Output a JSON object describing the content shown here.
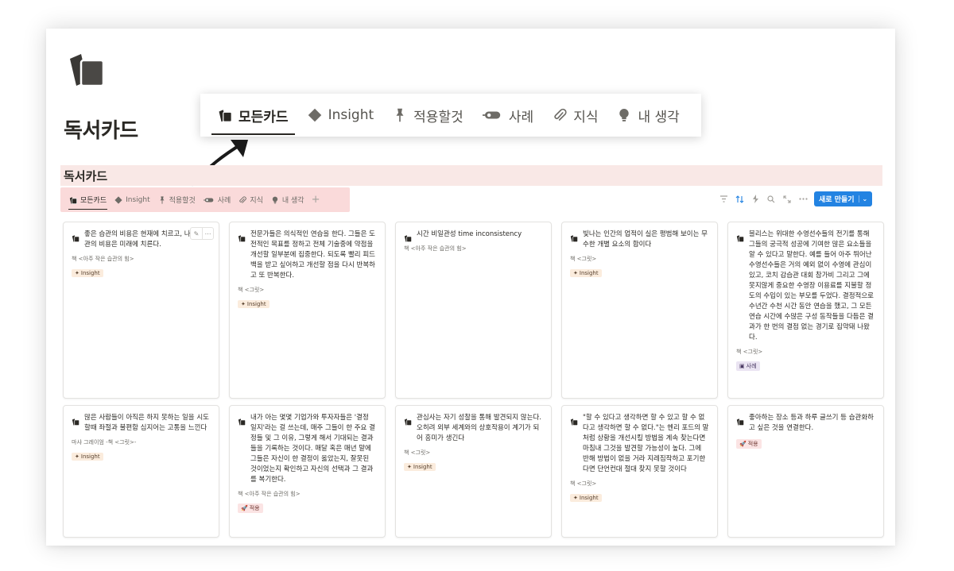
{
  "page": {
    "title": "독서카드",
    "database_title": "독서카드"
  },
  "zoom_tabs": [
    {
      "label": "모든카드",
      "icon": "cards-icon",
      "active": true
    },
    {
      "label": "Insight",
      "icon": "diamond-icon"
    },
    {
      "label": "적용할것",
      "icon": "pin-icon"
    },
    {
      "label": "사례",
      "icon": "tape-icon"
    },
    {
      "label": "지식",
      "icon": "paperclip-icon"
    },
    {
      "label": "내 생각",
      "icon": "lightbulb-icon"
    }
  ],
  "view_tabs": [
    {
      "label": "모든카드",
      "icon": "cards-icon",
      "active": true
    },
    {
      "label": "Insight",
      "icon": "diamond-icon"
    },
    {
      "label": "적용할것",
      "icon": "pin-icon"
    },
    {
      "label": "사례",
      "icon": "tape-icon"
    },
    {
      "label": "지식",
      "icon": "paperclip-icon"
    },
    {
      "label": "내 생각",
      "icon": "lightbulb-icon"
    }
  ],
  "view_add": "+",
  "toolbar": {
    "icons": [
      "filter-icon",
      "sort-icon",
      "automation-icon",
      "search-icon",
      "expand-icon",
      "more-icon"
    ],
    "new_button": "새로 만들기",
    "accent": "#2383e2"
  },
  "tags": {
    "insight": "Insight",
    "apply": "적용",
    "case": "사례"
  },
  "cards": [
    {
      "title": "좋은 습관의 비용은 현재에 치르고, 나쁜 습관의 비용은 미래에 치른다.",
      "book": "책 <아주 작은 습관의 힘>",
      "tag": "insight",
      "tag_label": "Insight",
      "show_actions": true
    },
    {
      "title": "전문가들은 의식적인 연습을 한다. 그들은 도전적인 목표를 정하고 전체 기술중에 약점을 개선할 일부분에 집중한다. 되도록 빨리 피드백을 받고 싶어하고 개선할 점을 다시 반복하고 또 반복한다.",
      "book": "책 <그릿>",
      "tag": "insight",
      "tag_label": "Insight"
    },
    {
      "title": "시간 비일관성 time inconsistency",
      "book": "책 <아주 작은 습관의 힘>",
      "tag": null
    },
    {
      "title": "빛나는 인간의 업적이 실은 평범해 보이는 무수한 개별 요소의 합이다",
      "book": "책 <그릿>",
      "tag": "insight",
      "tag_label": "Insight"
    },
    {
      "title": "블리스는 위대한 수영선수들의 전기를 통해 그들의 궁극적 성공에 기여한 많은 요소들을 알 수 있다고 말한다. 예를 들어 아주 뛰어난 수영선수들은 거의 예외 없이 수영에 관심이 있고, 코치 감습관 대회 참가비 그리고 그에 못지않게 중요한 수영장 이용료를 지불할 정도의 수입이 있는 부모를 두었다. 결정적으로 수년간 수천 시간 동안 연습을 했고, 그 모든 연습 시간에 수많은 구성 동작들을 다듬은 결과가 한 번의 결점 없는 경기로 집약돼 나왔다.",
      "book": "책 <그릿>",
      "tag": "case",
      "tag_label": "사례"
    },
    {
      "title": "많은 사람들이 아직은 하지 못하는 일을 시도할때 좌절과 불편함 심지어는 고통을 느낀다",
      "book": "마샤 그레이엄 -책 <그릿>-",
      "tag": "insight",
      "tag_label": "Insight"
    },
    {
      "title": "내가 아는 몇몇 기업가와 투자자들은 '결정 일지'라는 걸 쓰는데, 매주 그들이 한 주요 결정들 및 그 이유, 그렇게 해서 기대되는 결과들을 기록하는 것이다. 매달 혹은 매년 말에 그들은 자신이 한 결정이 옳았는지, 잘못된 것이었는지 확인하고 자신의 선택과 그 결과를 복기한다.",
      "book": "책 <아주 작은 습관의 힘>",
      "tag": "apply",
      "tag_label": "적용"
    },
    {
      "title": "관심사는 자기 성찰을 통해 발견되지 않는다. 오히려 외부 세계와의 상호작용이 계기가 되어 흥미가 생긴다",
      "book": "책 <그릿>",
      "tag": "insight",
      "tag_label": "Insight"
    },
    {
      "title": "\"할 수 있다고 생각하면 할 수 있고 할 수 없다고 생각하면 할 수 없다.\"는 헨리 포드의 말처럼 상황을 개선시킬 방법을 계속 찾는다면 마침내 그것을 발견할 가능성이 높다. 그에 반해 방법이 없을 거라 지레짐작하고 포기한다면 단언컨대 절대 찾지 못할 것이다",
      "book": "책 <그릿>",
      "tag": "insight",
      "tag_label": "Insight"
    },
    {
      "title": "좋아하는 장소 등과 하루 글쓰기 등 습관화하고 싶은 것을 연결한다.",
      "book": "",
      "tag": "apply",
      "tag_label": "적용"
    }
  ]
}
